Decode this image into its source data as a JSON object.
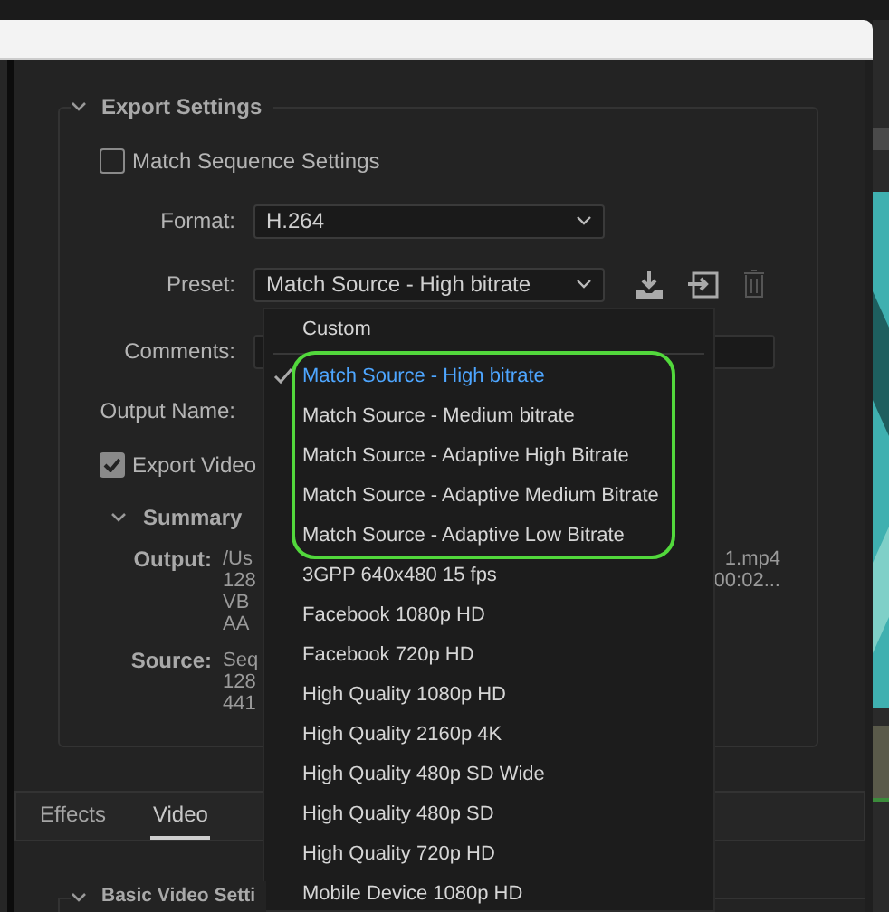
{
  "export_settings": {
    "title": "Export Settings",
    "expanded": true,
    "match_sequence": {
      "label": "Match Sequence Settings",
      "checked": false
    },
    "format": {
      "label": "Format:",
      "value": "H.264"
    },
    "preset": {
      "label": "Preset:",
      "value": "Match Source - High bitrate"
    },
    "comments": {
      "label": "Comments:"
    },
    "output_name": {
      "label": "Output Name:"
    },
    "export_video": {
      "label": "Export Video",
      "checked": true
    },
    "summary": {
      "title": "Summary",
      "expanded": true,
      "rows": [
        {
          "label": "Output:",
          "lines": [
            "/Us",
            "128",
            "VB",
            "AA"
          ],
          "right_lines": [
            "1.mp4",
            "00:02..."
          ]
        },
        {
          "label": "Source:",
          "lines": [
            "Seq",
            "128",
            "441"
          ],
          "right_lines": []
        }
      ]
    }
  },
  "tabs": [
    {
      "label": "Effects",
      "selected": false
    },
    {
      "label": "Video",
      "selected": true
    }
  ],
  "basic_video": {
    "title": "Basic Video Setti",
    "expanded": true
  },
  "preset_menu": {
    "items": [
      {
        "label": "Custom",
        "selected": false,
        "circled": false,
        "kind": "custom"
      },
      {
        "label": "Match Source - High bitrate",
        "selected": true,
        "circled": true,
        "kind": "preset"
      },
      {
        "label": "Match Source - Medium bitrate",
        "selected": false,
        "circled": true,
        "kind": "preset"
      },
      {
        "label": "Match Source - Adaptive High Bitrate",
        "selected": false,
        "circled": true,
        "kind": "preset"
      },
      {
        "label": "Match Source - Adaptive Medium Bitrate",
        "selected": false,
        "circled": true,
        "kind": "preset"
      },
      {
        "label": "Match Source - Adaptive Low Bitrate",
        "selected": false,
        "circled": true,
        "kind": "preset"
      },
      {
        "label": "3GPP 640x480 15 fps",
        "selected": false,
        "circled": false,
        "kind": "preset"
      },
      {
        "label": "Facebook 1080p HD",
        "selected": false,
        "circled": false,
        "kind": "preset"
      },
      {
        "label": "Facebook 720p HD",
        "selected": false,
        "circled": false,
        "kind": "preset"
      },
      {
        "label": "High Quality 1080p HD",
        "selected": false,
        "circled": false,
        "kind": "preset"
      },
      {
        "label": "High Quality 2160p 4K",
        "selected": false,
        "circled": false,
        "kind": "preset"
      },
      {
        "label": "High Quality 480p SD Wide",
        "selected": false,
        "circled": false,
        "kind": "preset"
      },
      {
        "label": "High Quality 480p SD",
        "selected": false,
        "circled": false,
        "kind": "preset"
      },
      {
        "label": "High Quality 720p HD",
        "selected": false,
        "circled": false,
        "kind": "preset"
      },
      {
        "label": "Mobile Device 1080p HD",
        "selected": false,
        "circled": false,
        "kind": "preset"
      }
    ]
  }
}
